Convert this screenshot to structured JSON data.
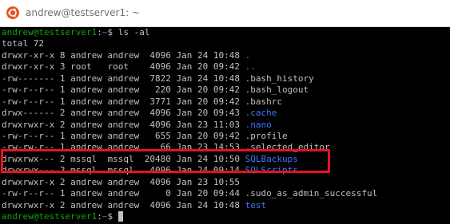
{
  "window": {
    "title": "andrew@testserver1: ~",
    "icon": "ubuntu-logo-icon",
    "accent_color": "#e95420"
  },
  "colors": {
    "background": "#000000",
    "text": "#c0c0c0",
    "prompt_user": "#13a10e",
    "prompt_path": "#3b78ff",
    "directory": "#3b78ff",
    "highlight_border": "#e81123"
  },
  "terminal": {
    "prompt1": {
      "user": "andrew@testserver1",
      "sep": ":",
      "path": "~",
      "symbol": "$",
      "command": " ls -al"
    },
    "total": "total 72",
    "entries": [
      {
        "meta": "drwxr-xr-x 8 andrew andrew  4096 Jan 24 10:48 ",
        "name": ".",
        "is_dir": true
      },
      {
        "meta": "drwxr-xr-x 3 root   root    4096 Jan 20 09:42 ",
        "name": "..",
        "is_dir": true
      },
      {
        "meta": "-rw------- 1 andrew andrew  7822 Jan 24 10:48 ",
        "name": ".bash_history",
        "is_dir": false
      },
      {
        "meta": "-rw-r--r-- 1 andrew andrew   220 Jan 20 09:42 ",
        "name": ".bash_logout",
        "is_dir": false
      },
      {
        "meta": "-rw-r--r-- 1 andrew andrew  3771 Jan 20 09:42 ",
        "name": ".bashrc",
        "is_dir": false
      },
      {
        "meta": "drwx------ 2 andrew andrew  4096 Jan 20 09:43 ",
        "name": ".cache",
        "is_dir": true
      },
      {
        "meta": "drwxrwxr-x 2 andrew andrew  4096 Jan 23 11:03 ",
        "name": ".nano",
        "is_dir": true
      },
      {
        "meta": "-rw-r--r-- 1 andrew andrew   655 Jan 20 09:42 ",
        "name": ".profile",
        "is_dir": false
      },
      {
        "meta": "-rw-rw-r-- 1 andrew andrew    66 Jan 23 14:53 ",
        "name": ".selected_editor",
        "is_dir": false
      },
      {
        "meta": "drwxrwx--- 2 mssql  mssql  20480 Jan 24 10:50 ",
        "name": "SQLBackups",
        "is_dir": true
      },
      {
        "meta": "drwxrwx--- 2 mssql  mssql   4096 Jan 24 09:14 ",
        "name": "SQLScripts",
        "is_dir": true
      },
      {
        "meta": "drwxrwxr-x 2 andrew andrew  4096 Jan 23 10:55 ",
        "name": "",
        "is_dir": true
      },
      {
        "meta": "-rw-r--r-- 1 andrew andrew     0 Jan 20 09:44 ",
        "name": ".sudo_as_admin_successful",
        "is_dir": false
      },
      {
        "meta": "drwxrwxr-x 2 andrew andrew  4096 Jan 24 10:48 ",
        "name": "test",
        "is_dir": true
      }
    ],
    "prompt2": {
      "user": "andrew@testserver1",
      "sep": ":",
      "path": "~",
      "symbol": "$"
    }
  }
}
